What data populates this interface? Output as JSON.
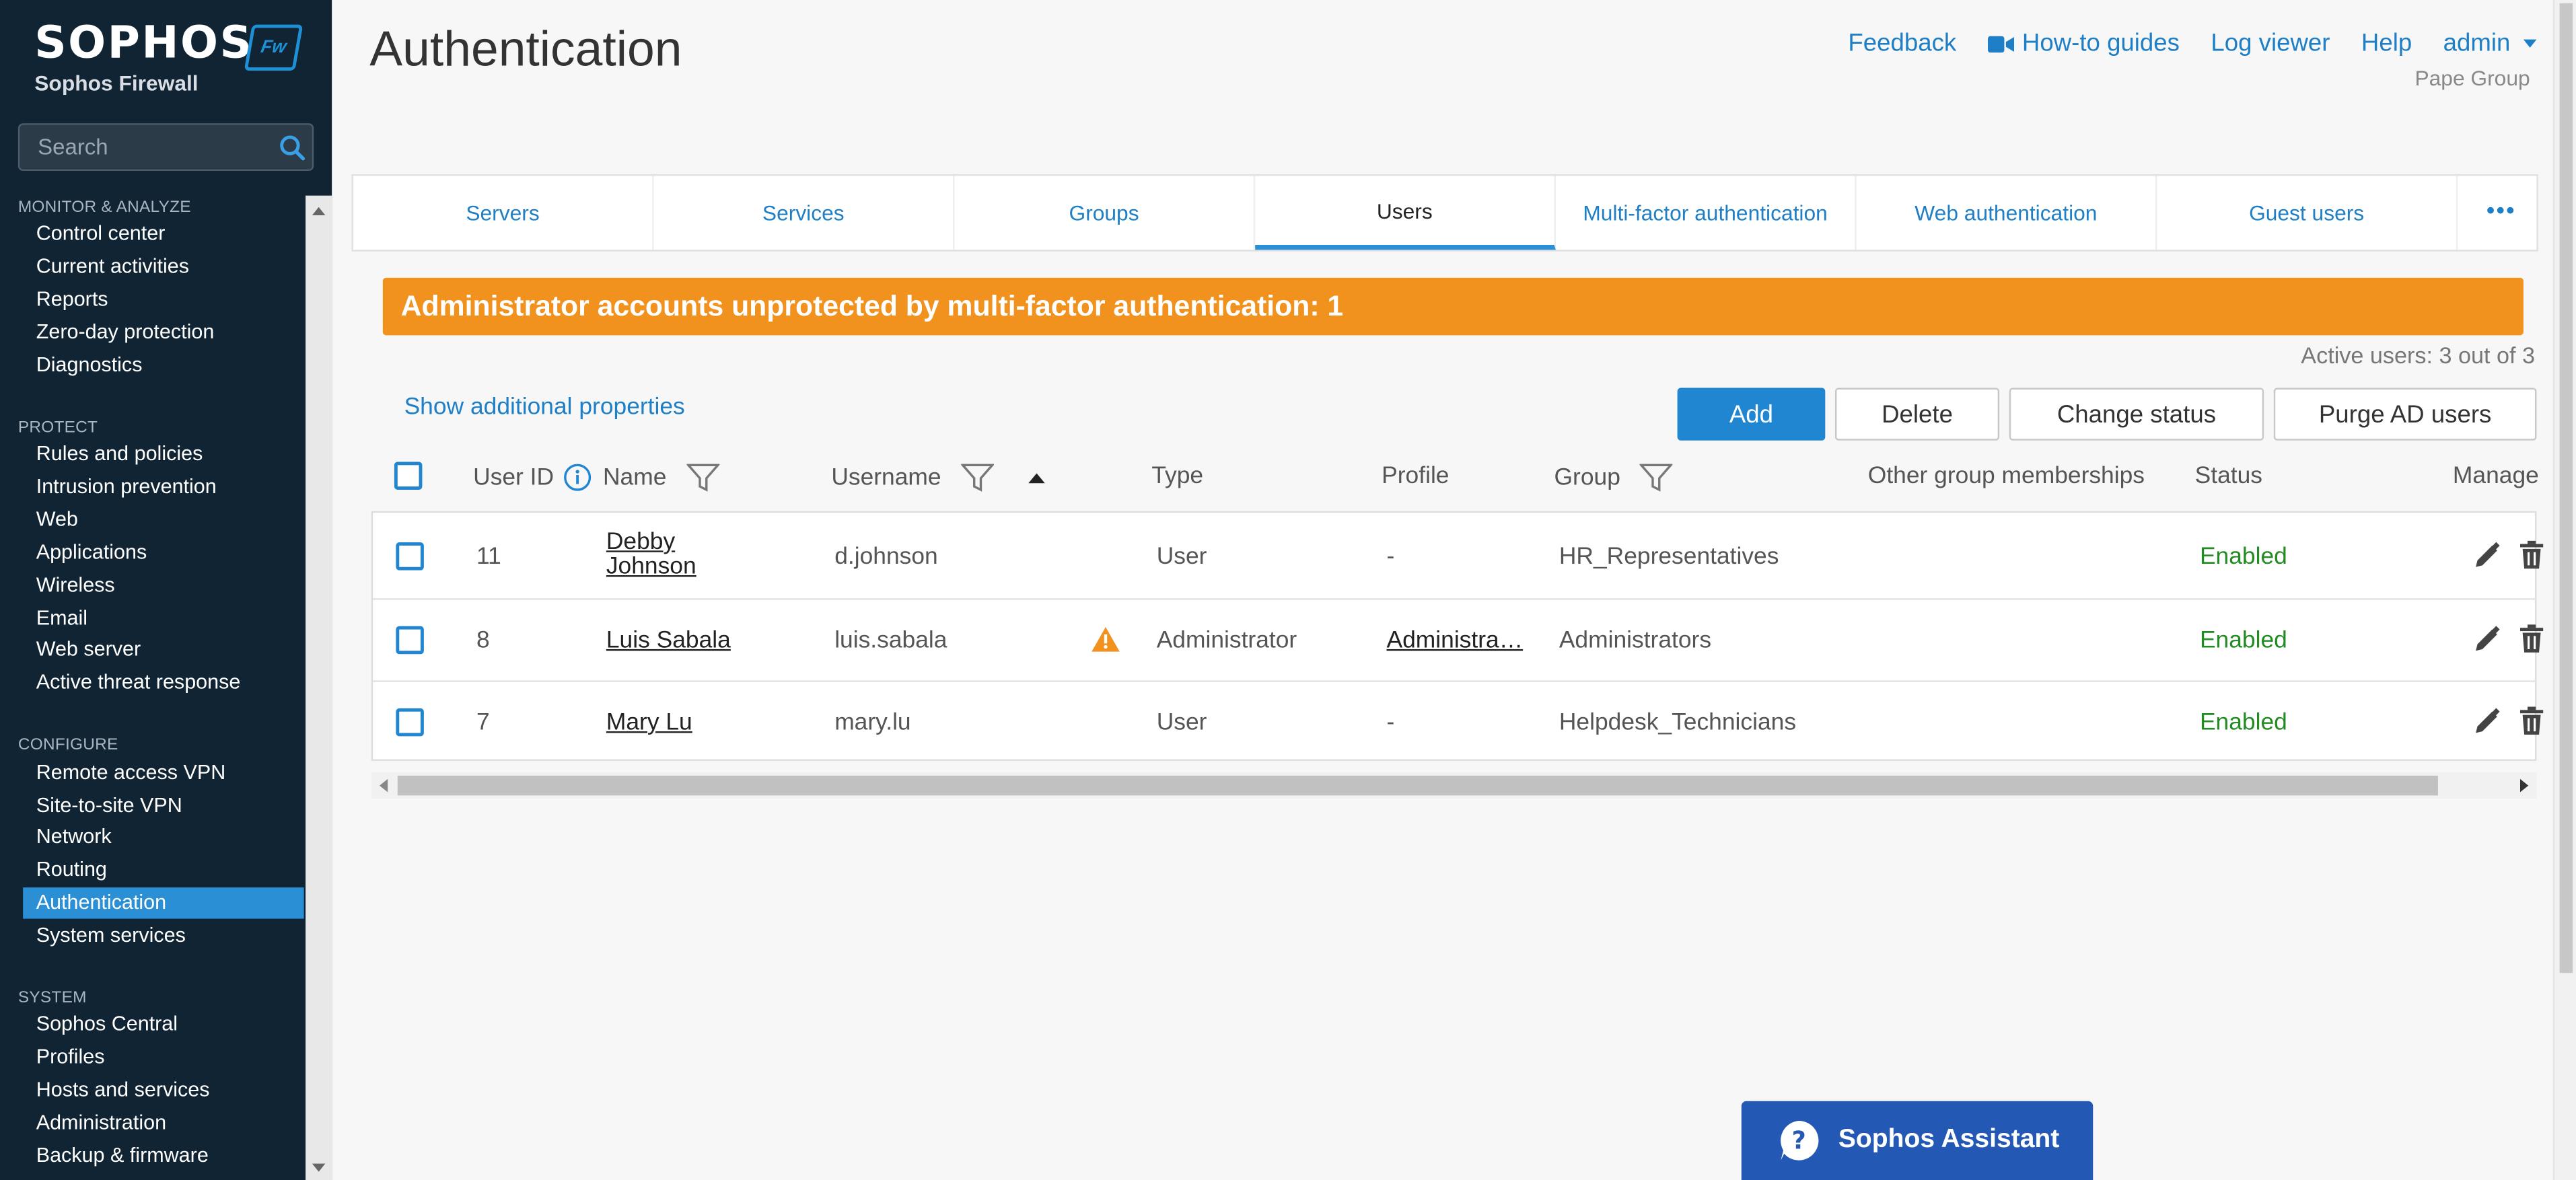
{
  "brand": {
    "logo": "SOPHOS",
    "product": "Sophos Firewall",
    "badge": "Fw"
  },
  "sidebar": {
    "search_placeholder": "Search",
    "sections": [
      {
        "title": "MONITOR & ANALYZE",
        "items": [
          "Control center",
          "Current activities",
          "Reports",
          "Zero-day protection",
          "Diagnostics"
        ]
      },
      {
        "title": "PROTECT",
        "items": [
          "Rules and policies",
          "Intrusion prevention",
          "Web",
          "Applications",
          "Wireless",
          "Email",
          "Web server",
          "Active threat response"
        ]
      },
      {
        "title": "CONFIGURE",
        "items": [
          "Remote access VPN",
          "Site-to-site VPN",
          "Network",
          "Routing",
          "Authentication",
          "System services"
        ]
      },
      {
        "title": "SYSTEM",
        "items": [
          "Sophos Central",
          "Profiles",
          "Hosts and services",
          "Administration",
          "Backup & firmware"
        ]
      }
    ],
    "active_item": "Authentication"
  },
  "header": {
    "title": "Authentication",
    "links": {
      "feedback": "Feedback",
      "howto": "How-to guides",
      "logviewer": "Log viewer",
      "help": "Help",
      "admin": "admin"
    },
    "org": "Pape Group"
  },
  "tabs": [
    "Servers",
    "Services",
    "Groups",
    "Users",
    "Multi-factor authentication",
    "Web authentication",
    "Guest users"
  ],
  "active_tab": "Users",
  "alert": "Administrator accounts unprotected by multi-factor authentication: 1",
  "active_users": "Active users: 3 out of 3",
  "show_props": "Show additional properties",
  "buttons": {
    "add": "Add",
    "delete": "Delete",
    "change_status": "Change status",
    "purge": "Purge AD users"
  },
  "table": {
    "headers": {
      "user_id": "User ID",
      "name": "Name",
      "username": "Username",
      "type": "Type",
      "profile": "Profile",
      "group": "Group",
      "other_groups": "Other group memberships",
      "status": "Status",
      "manage": "Manage"
    },
    "rows": [
      {
        "id": "11",
        "name_line1": "Debby",
        "name_line2": "Johnson",
        "username": "d.johnson",
        "type": "User",
        "profile": "-",
        "group": "HR_Representatives",
        "status": "Enabled",
        "warning": false
      },
      {
        "id": "8",
        "name_line1": "Luis Sabala",
        "name_line2": "",
        "username": "luis.sabala",
        "type": "Administrator",
        "profile": "Administra…",
        "group": "Administrators",
        "status": "Enabled",
        "warning": true
      },
      {
        "id": "7",
        "name_line1": "Mary Lu",
        "name_line2": "",
        "username": "mary.lu",
        "type": "User",
        "profile": "-",
        "group": "Helpdesk_Technicians",
        "status": "Enabled",
        "warning": false
      }
    ]
  },
  "assistant": "Sophos Assistant",
  "colors": {
    "sidebar_bg": "#112433",
    "accent": "#2186d1",
    "alert": "#f0921d",
    "enabled": "#228b22",
    "assistant": "#2358b4"
  }
}
